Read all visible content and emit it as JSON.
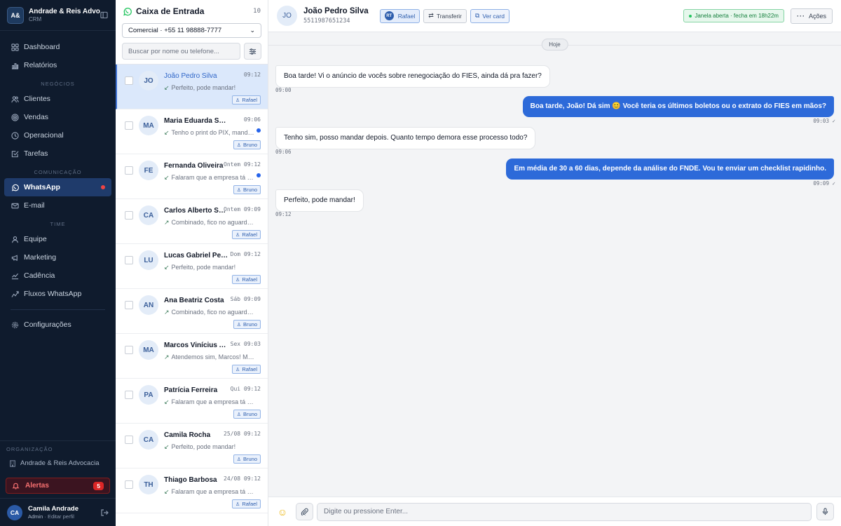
{
  "sidebar": {
    "logo": "A&",
    "brand": "Andrade & Reis Advocacia",
    "sub": "CRM",
    "items_top": [
      {
        "label": "Dashboard",
        "icon": "grid-icon"
      },
      {
        "label": "Relatórios",
        "icon": "bar-chart-icon"
      }
    ],
    "sec_negocios": "NEGÓCIOS",
    "items_negocios": [
      {
        "label": "Clientes",
        "icon": "users-icon"
      },
      {
        "label": "Vendas",
        "icon": "target-icon"
      },
      {
        "label": "Operacional",
        "icon": "clock-icon"
      },
      {
        "label": "Tarefas",
        "icon": "checkbox-icon"
      }
    ],
    "sec_comunicacao": "COMUNICAÇÃO",
    "items_comunicacao": [
      {
        "label": "WhatsApp",
        "icon": "whatsapp-icon",
        "active": true
      },
      {
        "label": "E-mail",
        "icon": "mail-icon"
      }
    ],
    "sec_time": "TIME",
    "items_time": [
      {
        "label": "Equipe",
        "icon": "user-icon"
      },
      {
        "label": "Marketing",
        "icon": "megaphone-icon"
      },
      {
        "label": "Cadência",
        "icon": "trend-icon"
      },
      {
        "label": "Fluxos WhatsApp",
        "icon": "flow-icon"
      }
    ],
    "settings": "Configurações",
    "org_label": "ORGANIZAÇÃO",
    "org_name": "Andrade & Reis Advocacia",
    "alerts_label": "Alertas",
    "alerts_count": "5",
    "user_initials": "CA",
    "user_name": "Camila Andrade",
    "user_role": "Admin",
    "user_edit": "· Editar perfil"
  },
  "inbox": {
    "title": "Caixa de Entrada",
    "count": "10",
    "channel": "Comercial · +55 11 98888-7777",
    "search_placeholder": "Buscar por nome ou telefone...",
    "conversations": [
      {
        "initials": "JO",
        "name": "João Pedro Silva",
        "time": "09:12",
        "preview": "Perfeito, pode mandar!",
        "direction": "in",
        "agent": "Rafael",
        "unread": false,
        "active": true
      },
      {
        "initials": "MA",
        "name": "Maria Eduarda Santos",
        "time": "09:06",
        "preview": "Tenho o print do PIX, mando agora",
        "direction": "in",
        "agent": "Bruno",
        "unread": true,
        "active": false
      },
      {
        "initials": "FE",
        "name": "Fernanda Oliveira",
        "time": "Ontem 09:12",
        "preview": "Falaram que a empresa tá cobrando",
        "direction": "in",
        "agent": "Bruno",
        "unread": true,
        "active": false
      },
      {
        "initials": "CA",
        "name": "Carlos Alberto Souza",
        "time": "Ontem 09:09",
        "preview": "Combinado, fico no aguardo 👍",
        "direction": "out",
        "agent": "Rafael",
        "unread": false,
        "active": false
      },
      {
        "initials": "LU",
        "name": "Lucas Gabriel Pereira",
        "time": "Dom 09:12",
        "preview": "Perfeito, pode mandar!",
        "direction": "in",
        "agent": "Rafael",
        "unread": false,
        "active": false
      },
      {
        "initials": "AN",
        "name": "Ana Beatriz Costa",
        "time": "Sáb 09:09",
        "preview": "Combinado, fico no aguardo 👍",
        "direction": "out",
        "agent": "Bruno",
        "unread": false,
        "active": false
      },
      {
        "initials": "MA",
        "name": "Marcos Vinícius Almeida",
        "time": "Sex 09:03",
        "preview": "Atendemos sim, Marcos! Me conta",
        "direction": "out",
        "agent": "Rafael",
        "unread": false,
        "active": false
      },
      {
        "initials": "PA",
        "name": "Patrícia Ferreira",
        "time": "Qui 09:12",
        "preview": "Falaram que a empresa tá cobrando",
        "direction": "in",
        "agent": "Bruno",
        "unread": false,
        "active": false
      },
      {
        "initials": "CA",
        "name": "Camila Rocha",
        "time": "25/08 09:12",
        "preview": "Perfeito, pode mandar!",
        "direction": "in",
        "agent": "Bruno",
        "unread": false,
        "active": false
      },
      {
        "initials": "TH",
        "name": "Thiago Barbosa",
        "time": "24/08 09:12",
        "preview": "Falaram que a empresa tá cobrando",
        "direction": "in",
        "agent": "Rafael",
        "unread": false,
        "active": false
      }
    ]
  },
  "chat": {
    "initials": "JO",
    "name": "João Pedro Silva",
    "phone": "5511987651234",
    "assignee_initials": "RT",
    "assignee": "Rafael",
    "transfer": "Transferir",
    "view_card": "Ver card",
    "window": "Janela aberta · fecha em 18h22m",
    "actions": "Ações",
    "day": "Hoje",
    "messages": [
      {
        "dir": "in",
        "text": "Boa tarde! Vi o anúncio de vocês sobre renegociação do FIES, ainda dá pra fazer?",
        "time": "09:00"
      },
      {
        "dir": "out",
        "text": "Boa tarde, João! Dá sim 😊 Você teria os últimos boletos ou o extrato do FIES em mãos?",
        "time": "09:03 ✓"
      },
      {
        "dir": "in",
        "text": "Tenho sim, posso mandar depois. Quanto tempo demora esse processo todo?",
        "time": "09:06"
      },
      {
        "dir": "out",
        "text": "Em média de 30 a 60 dias, depende da análise do FNDE. Vou te enviar um checklist rapidinho.",
        "time": "09:09 ✓"
      },
      {
        "dir": "in",
        "text": "Perfeito, pode mandar!",
        "time": "09:12"
      }
    ],
    "input_placeholder": "Digite ou pressione Enter..."
  }
}
